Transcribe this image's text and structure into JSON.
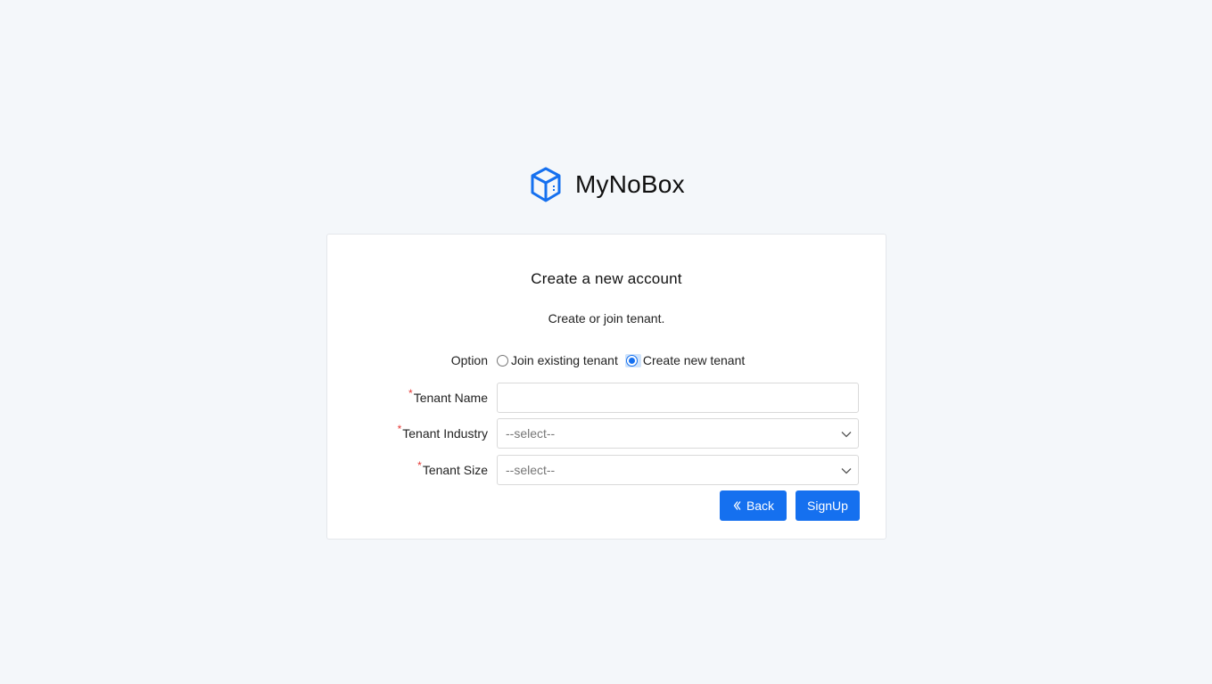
{
  "brand": {
    "name": "MyNoBox",
    "logo_icon": "cube-icon",
    "accent": "#1570ef"
  },
  "card": {
    "title": "Create a new account",
    "subtitle": "Create or join tenant."
  },
  "form": {
    "option": {
      "label": "Option",
      "choices": [
        {
          "label": "Join existing tenant",
          "selected": false
        },
        {
          "label": "Create new tenant",
          "selected": true
        }
      ]
    },
    "tenant_name": {
      "label": "Tenant Name",
      "required_mark": "*",
      "value": ""
    },
    "tenant_industry": {
      "label": "Tenant Industry",
      "required_mark": "*",
      "selected": "--select--"
    },
    "tenant_size": {
      "label": "Tenant Size",
      "required_mark": "*",
      "selected": "--select--"
    }
  },
  "buttons": {
    "back_label": "Back",
    "back_icon": "double-chevron-left-icon",
    "signup_label": "SignUp"
  },
  "colors": {
    "primary": "#1570ef",
    "required": "#e53935",
    "background": "#f4f7fa"
  }
}
